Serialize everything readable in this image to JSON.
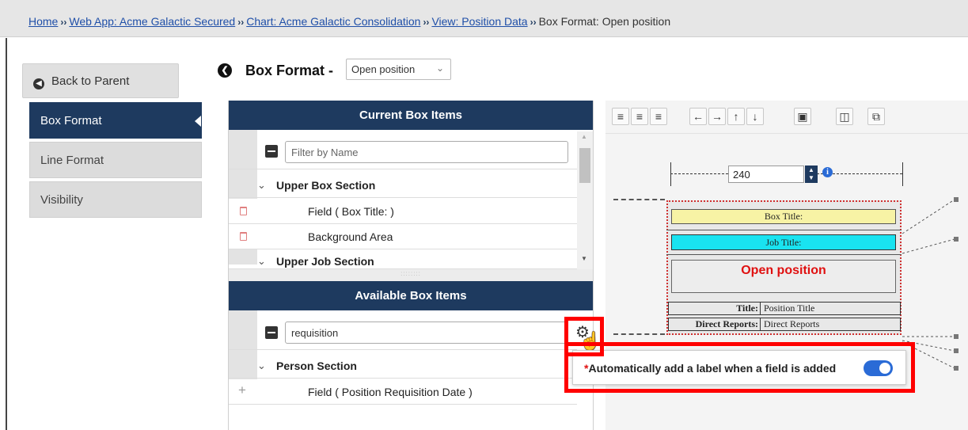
{
  "breadcrumb": {
    "items": [
      {
        "label": "Home",
        "link": true
      },
      {
        "label": "Web App: Acme Galactic Secured",
        "link": true
      },
      {
        "label": "Chart: Acme Galactic Consolidation",
        "link": true
      },
      {
        "label": "View: Position Data",
        "link": true
      },
      {
        "label": "Box Format: Open position",
        "link": false
      }
    ],
    "separator": "››"
  },
  "sidebar": {
    "back_label": "Back to Parent",
    "items": [
      {
        "label": "Box Format",
        "active": true
      },
      {
        "label": "Line Format",
        "active": false
      },
      {
        "label": "Visibility",
        "active": false
      }
    ]
  },
  "header": {
    "title": "Box Format -",
    "select_value": "Open position"
  },
  "current_items": {
    "title": "Current Box Items",
    "filter_placeholder": "Filter by Name",
    "rows": [
      {
        "type": "section",
        "label": "Upper Box Section"
      },
      {
        "type": "item",
        "label": "Field  ( Box Title: )",
        "action": "delete"
      },
      {
        "type": "item",
        "label": "Background Area",
        "action": "delete"
      },
      {
        "type": "section",
        "label": "Upper Job Section"
      }
    ]
  },
  "available_items": {
    "title": "Available Box Items",
    "filter_value": "requisition",
    "rows": [
      {
        "type": "section",
        "label": "Person Section"
      },
      {
        "type": "item",
        "label": "Field  ( Position Requisition Date )",
        "action": "add"
      }
    ]
  },
  "design": {
    "width_value": "240",
    "box_title": "Box Title:",
    "job_title": "Job Title:",
    "open_position": "Open position",
    "fields": [
      {
        "label": "Title:",
        "value": "Position Title"
      },
      {
        "label": "Direct Reports:",
        "value": "Direct Reports"
      }
    ]
  },
  "popup": {
    "required_mark": "*",
    "text": "Automatically add a label when a field is added",
    "toggle_on": true
  },
  "colors": {
    "primary": "#1e3a5f",
    "highlight": "#ff0000",
    "box_title_fill": "#f7f3a5",
    "job_title_fill": "#19e3f0",
    "toggle": "#2a6bd6"
  }
}
